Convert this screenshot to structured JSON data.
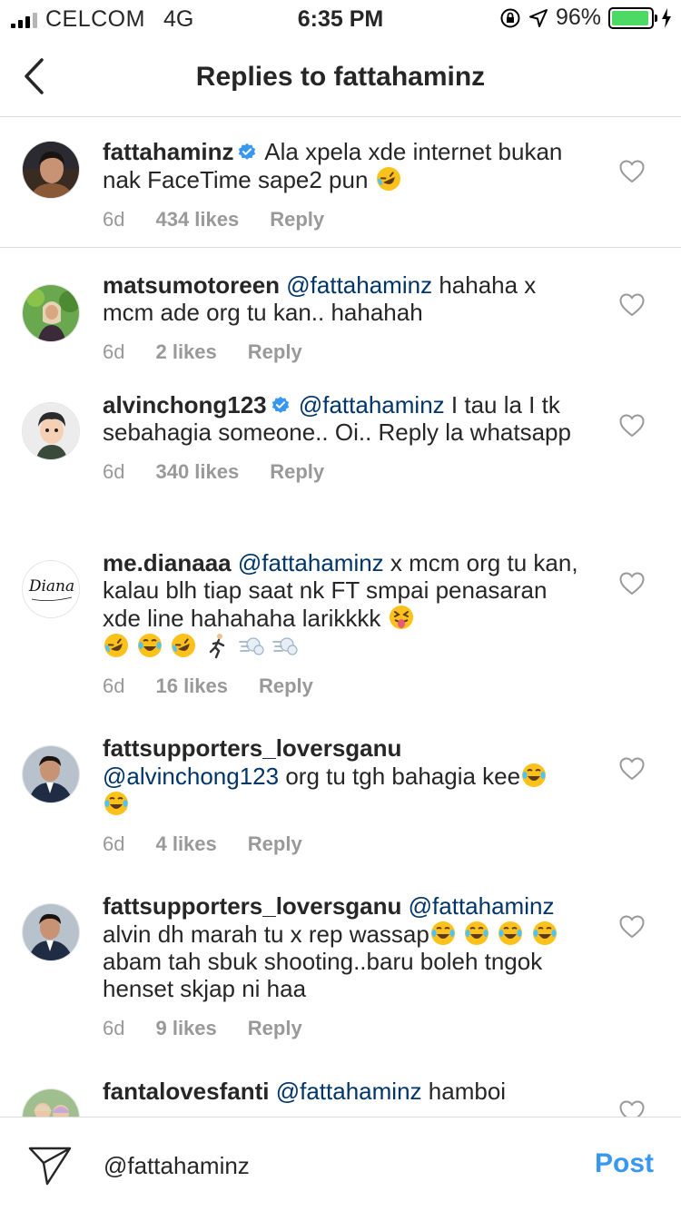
{
  "status_bar": {
    "carrier": "CELCOM",
    "network": "4G",
    "time": "6:35 PM",
    "battery": "96%",
    "battery_level": 0.96
  },
  "nav": {
    "title": "Replies to fattahaminz"
  },
  "comments": [
    {
      "username": "fattahaminz",
      "verified": true,
      "mention": "",
      "text": "Ala xpela xde internet bukan nak FaceTime sape2 pun",
      "age": "6d",
      "likes": "434 likes",
      "reply": "Reply"
    },
    {
      "username": "matsumotoreen",
      "verified": false,
      "mention": "@fattahaminz",
      "text": "hahaha x mcm ade org tu kan.. hahahah",
      "age": "6d",
      "likes": "2 likes",
      "reply": "Reply"
    },
    {
      "username": "alvinchong123",
      "verified": true,
      "mention": "@fattahaminz",
      "text": "I tau la I tk sebahagia someone.. Oi.. Reply la whatsapp",
      "age": "6d",
      "likes": "340 likes",
      "reply": "Reply"
    },
    {
      "username": "me.dianaaa",
      "verified": false,
      "mention": "@fattahaminz",
      "text": "x mcm org tu kan, kalau blh tiap saat nk FT smpai penasaran xde line hahahaha larikkkk",
      "age": "6d",
      "likes": "16 likes",
      "reply": "Reply"
    },
    {
      "username": "fattsupporters_loversganu",
      "verified": false,
      "mention": "@alvinchong123",
      "text": "org tu tgh bahagia kee",
      "age": "6d",
      "likes": "4 likes",
      "reply": "Reply"
    },
    {
      "username": "fattsupporters_loversganu",
      "verified": false,
      "mention": "@fattahaminz",
      "text": "alvin dh marah tu x rep wassap",
      "text2": "abam tah sbuk shooting..baru boleh tngok henset skjap ni haa",
      "age": "6d",
      "likes": "9 likes",
      "reply": "Reply"
    },
    {
      "username": "fantalovesfanti",
      "verified": false,
      "mention": "@fattahaminz",
      "text": "hamboi"
    }
  ],
  "avatar_logo_text": "Diana",
  "composer": {
    "value": "@fattahaminz",
    "post_label": "Post"
  },
  "colors": {
    "link": "#003569",
    "post": "#3897f0",
    "meta": "#999999",
    "battery": "#4cd964",
    "verified": "#3897f0"
  }
}
